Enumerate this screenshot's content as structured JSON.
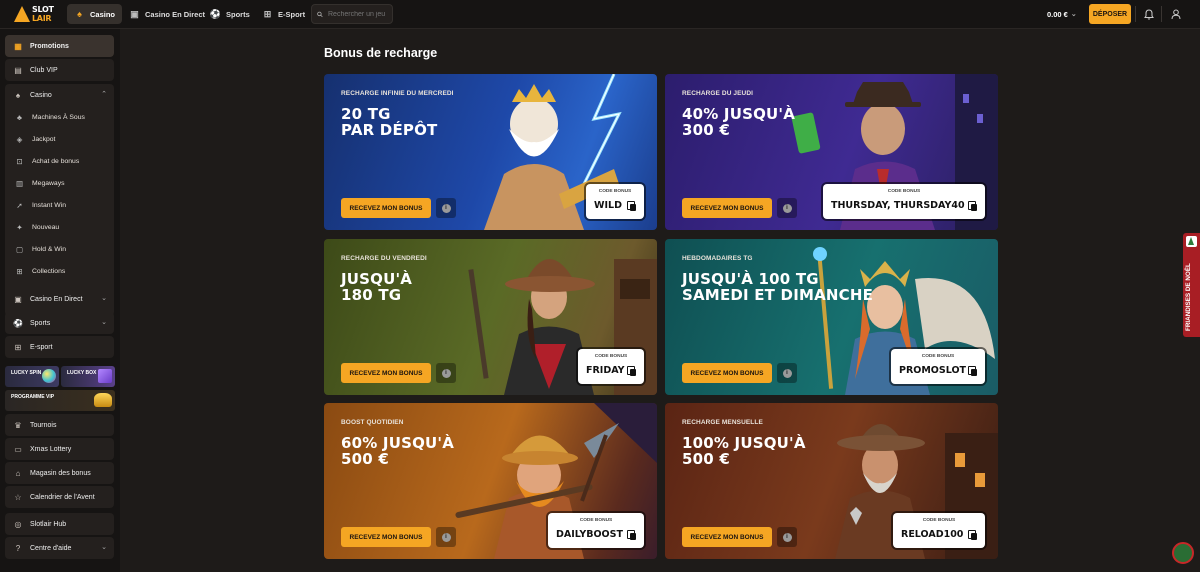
{
  "brand": {
    "line1": "SLOT",
    "line2": "LAIR"
  },
  "topnav": [
    {
      "label": "Casino",
      "icon": "spade-icon",
      "active": true
    },
    {
      "label": "Casino En Direct",
      "icon": "live-cards-icon"
    },
    {
      "label": "Sports",
      "icon": "soccer-ball-icon"
    },
    {
      "label": "E-Sport",
      "icon": "gamepad-icon"
    }
  ],
  "search": {
    "placeholder": "Rechercher un jeu"
  },
  "account": {
    "balance": "0.00 €",
    "deposit_label": "DÉPOSER"
  },
  "sidebar": {
    "promotions": "Promotions",
    "club_vip": "Club VIP",
    "casino": "Casino",
    "casino_items": [
      "Machines À Sous",
      "Jackpot",
      "Achat de bonus",
      "Megaways",
      "Instant Win",
      "Nouveau",
      "Hold & Win",
      "Collections"
    ],
    "casino_live": "Casino En Direct",
    "sports": "Sports",
    "esport": "E-sport",
    "lucky_spin": "LUCKY SPIN",
    "lucky_box": "LUCKY BOX",
    "programme_vip": "PROGRAMME VIP",
    "tournois": "Tournois",
    "xmas_lottery": "Xmas Lottery",
    "magasin": "Magasin des bonus",
    "calendrier": "Calendrier de l'Avent",
    "hub": "Slotlair Hub",
    "aide": "Centre d'aide"
  },
  "main": {
    "title": "Bonus de recharge",
    "cta_label": "RECEVEZ MON BONUS",
    "code_label": "CODE BONUS",
    "cards": [
      {
        "kicker": "RECHARGE INFINIE DU MERCREDI",
        "headline_1": "20 TG",
        "headline_2": "PAR DÉPÔT",
        "code": "WILD",
        "theme": "#1d3e8a"
      },
      {
        "kicker": "RECHARGE DU JEUDI",
        "headline_1": "40% JUSQU'À",
        "headline_2": "300 €",
        "code": "THURSDAY, THURSDAY40",
        "theme": "#3d2a8a"
      },
      {
        "kicker": "RECHARGE DU VENDREDI",
        "headline_1": "JUSQU'À",
        "headline_2": "180 TG",
        "code": "FRIDAY",
        "theme": "#4e5a22"
      },
      {
        "kicker": "HEBDOMADAIRES TG",
        "headline_1": "JUSQU'À 100 TG",
        "headline_2": "SAMEDI ET DIMANCHE",
        "code": "PROMOSLOT",
        "theme": "#166b6b"
      },
      {
        "kicker": "BOOST QUOTIDIEN",
        "headline_1": "60% JUSQU'À",
        "headline_2": "500 €",
        "code": "DAILYBOOST",
        "theme": "#b2651a"
      },
      {
        "kicker": "RECHARGE MENSUELLE",
        "headline_1": "100% JUSQU'À",
        "headline_2": "500 €",
        "code": "RELOAD100",
        "theme": "#7a3d1c"
      }
    ]
  },
  "side_tab": "FRIANDISES DE NOËL",
  "colors": {
    "accent": "#f5a623",
    "background": "#1e1b19",
    "sidebar": "#161413"
  }
}
